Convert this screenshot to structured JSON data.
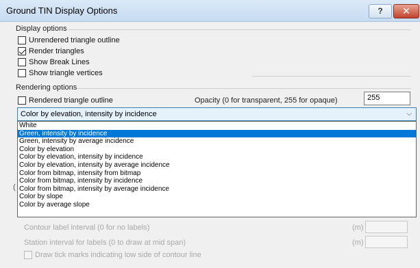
{
  "window": {
    "title": "Ground TIN Display Options",
    "help_glyph": "?",
    "close_glyph": "✕"
  },
  "display_options": {
    "label": "Display options",
    "items": [
      {
        "label": "Unrendered triangle outline",
        "checked": false
      },
      {
        "label": "Render triangles",
        "checked": true
      },
      {
        "label": "Show Break Lines",
        "checked": false
      },
      {
        "label": "Show triangle vertices",
        "checked": false
      }
    ]
  },
  "rendering_options": {
    "label": "Rendering options",
    "outline_label": "Rendered triangle outline",
    "outline_checked": false,
    "opacity_label": "Opacity (0 for transparent, 255 for opaque)",
    "opacity_value": "255",
    "color_mode_selected": "Color by elevation, intensity by incidence",
    "dropdown_arrow": "⌵",
    "options": [
      "White",
      "Green, intensity by incidence",
      "Green, intensity by average incidence",
      "Color by elevation",
      "Color by elevation, intensity by incidence",
      "Color by elevation, intensity by average incidence",
      "Color from bitmap, intensity from bitmap",
      "Color from bitmap, intensity by incidence",
      "Color from bitmap, intensity by average incidence",
      "Color by slope",
      "Color by average slope"
    ],
    "highlighted_index": 1
  },
  "contours": {
    "partial_label": "(",
    "label_interval_label": "Contour label interval (0 for no labels)",
    "label_interval_unit": "(m)",
    "station_interval_label": "Station interval for labels (0 to draw at mid span)",
    "station_interval_unit": "(m)",
    "tick_marks_label": "Draw tick marks indicating low side of contour line"
  }
}
